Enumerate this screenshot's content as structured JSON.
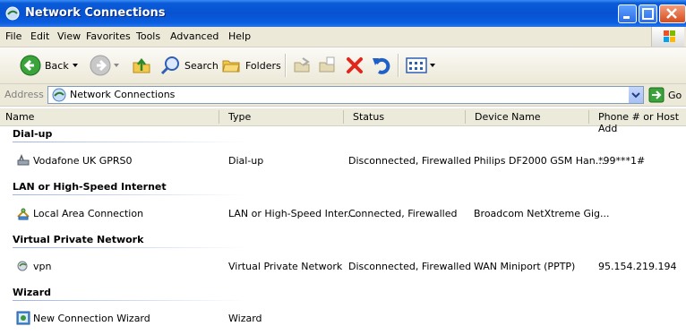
{
  "window": {
    "title": "Network Connections",
    "icons": {
      "app": "network-connections-icon",
      "minimize": "minimize-icon",
      "maximize": "maximize-icon",
      "close": "close-icon"
    }
  },
  "menu": [
    "File",
    "Edit",
    "View",
    "Favorites",
    "Tools",
    "Advanced",
    "Help"
  ],
  "toolbar": {
    "back_label": "Back",
    "search_label": "Search",
    "folders_label": "Folders"
  },
  "address": {
    "label": "Address",
    "value": "Network Connections",
    "go_label": "Go"
  },
  "columns": [
    "Name",
    "Type",
    "Status",
    "Device Name",
    "Phone # or Host Add"
  ],
  "groups": [
    {
      "title": "Dial-up",
      "items": [
        {
          "name": "Vodafone UK GPRS0",
          "type": "Dial-up",
          "status": "Disconnected, Firewalled",
          "device": "Philips DF2000 GSM Han...",
          "phone": "*99***1#",
          "icon": "dialup-modem-icon"
        }
      ]
    },
    {
      "title": "LAN or High-Speed Internet",
      "items": [
        {
          "name": "Local Area Connection",
          "type": "LAN or High-Speed Inter...",
          "status": "Connected, Firewalled",
          "device": "Broadcom NetXtreme Gig...",
          "phone": "",
          "icon": "lan-connection-icon"
        }
      ]
    },
    {
      "title": "Virtual Private Network",
      "items": [
        {
          "name": "vpn",
          "type": "Virtual Private Network",
          "status": "Disconnected, Firewalled",
          "device": "WAN Miniport (PPTP)",
          "phone": "95.154.219.194",
          "icon": "vpn-connection-icon"
        }
      ]
    },
    {
      "title": "Wizard",
      "items": [
        {
          "name": "New Connection Wizard",
          "type": "Wizard",
          "status": "",
          "device": "",
          "phone": "",
          "icon": "wizard-icon"
        }
      ]
    }
  ],
  "colors": {
    "titlebar": "#0752d2",
    "menubar": "#ece9d8",
    "group_line": "#9db4e3"
  }
}
